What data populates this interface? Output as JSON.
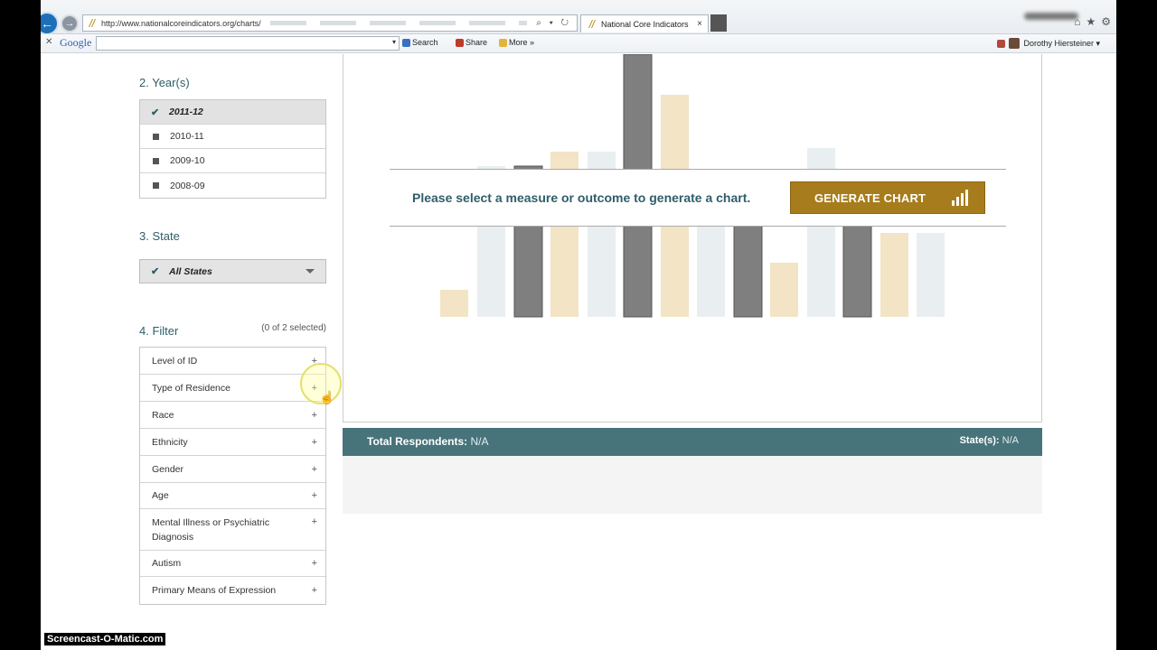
{
  "browser": {
    "url": "http://www.nationalcoreindicators.org/charts/",
    "tab_title": "National Core Indicators",
    "tab_close": "×",
    "back_glyph": "←",
    "forward_glyph": "→",
    "address_tools": "⌕ ▾ ↻",
    "window_controls": [
      "⌂",
      "★",
      "⚙"
    ]
  },
  "toolbar": {
    "close": "✕",
    "google": "Google",
    "search_label": "Search",
    "share_label": "Share",
    "more_label": "More »",
    "user_name": "Dorothy Hiersteiner ▾"
  },
  "sidebar": {
    "years": {
      "title": "2. Year(s)",
      "items": [
        {
          "label": "2011-12",
          "selected": true
        },
        {
          "label": "2010-11",
          "selected": false
        },
        {
          "label": "2009-10",
          "selected": false
        },
        {
          "label": "2008-09",
          "selected": false
        }
      ]
    },
    "state": {
      "title": "3. State",
      "selected": "All States"
    },
    "filter": {
      "title": "4. Filter",
      "count": "(0 of 2 selected)",
      "items": [
        "Level of ID",
        "Type of Residence",
        "Race",
        "Ethnicity",
        "Gender",
        "Age",
        "Mental Illness or Psychiatric Diagnosis",
        "Autism",
        "Primary Means of Expression"
      ],
      "expand_glyph": "+"
    }
  },
  "chart": {
    "prompt": "Please select a measure or outcome to generate a chart.",
    "generate_label": "GENERATE CHART",
    "colors": {
      "tan": "#f3e4c6",
      "gray": "#7f7f7f",
      "light": "#e9eef0"
    }
  },
  "summary": {
    "total_label": "Total Respondents:",
    "total_value": "N/A",
    "states_label": "State(s):",
    "states_value": "N/A"
  },
  "watermark": "Screencast-O-Matic.com"
}
